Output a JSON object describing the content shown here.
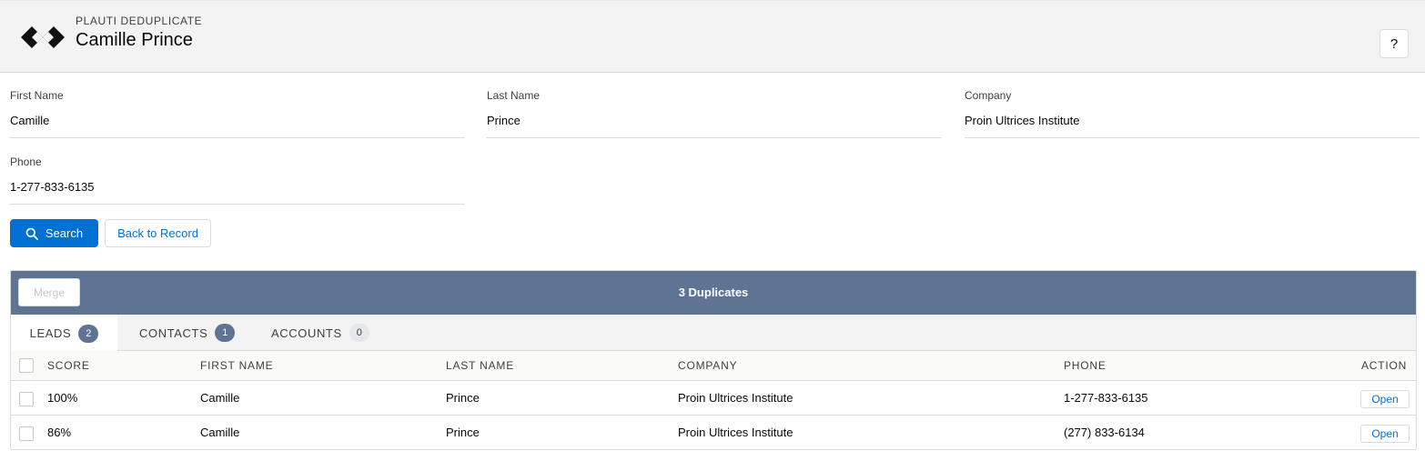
{
  "header": {
    "app_name": "PLAUTI DEDUPLICATE",
    "record_title": "Camille Prince",
    "help_label": "?"
  },
  "form": {
    "first_name": {
      "label": "First Name",
      "value": "Camille"
    },
    "last_name": {
      "label": "Last Name",
      "value": "Prince"
    },
    "company": {
      "label": "Company",
      "value": "Proin Ultrices Institute"
    },
    "phone": {
      "label": "Phone",
      "value": "1-277-833-6135"
    }
  },
  "actions": {
    "search_label": "Search",
    "back_label": "Back to Record"
  },
  "results": {
    "merge_label": "Merge",
    "duplicate_count": "3 Duplicates",
    "tabs": [
      {
        "label": "LEADS",
        "count": "2"
      },
      {
        "label": "CONTACTS",
        "count": "1"
      },
      {
        "label": "ACCOUNTS",
        "count": "0"
      }
    ],
    "columns": [
      "SCORE",
      "FIRST NAME",
      "LAST NAME",
      "COMPANY",
      "PHONE",
      "ACTION"
    ],
    "rows": [
      {
        "score": "100%",
        "first_name": "Camille",
        "last_name": "Prince",
        "company": "Proin Ultrices Institute",
        "phone": "1-277-833-6135",
        "action": "Open"
      },
      {
        "score": "86%",
        "first_name": "Camille",
        "last_name": "Prince",
        "company": "Proin Ultrices Institute",
        "phone": "(277) 833-6134",
        "action": "Open"
      }
    ]
  },
  "colors": {
    "brand_blue": "#0070d2",
    "panel_header": "#5f7393"
  }
}
